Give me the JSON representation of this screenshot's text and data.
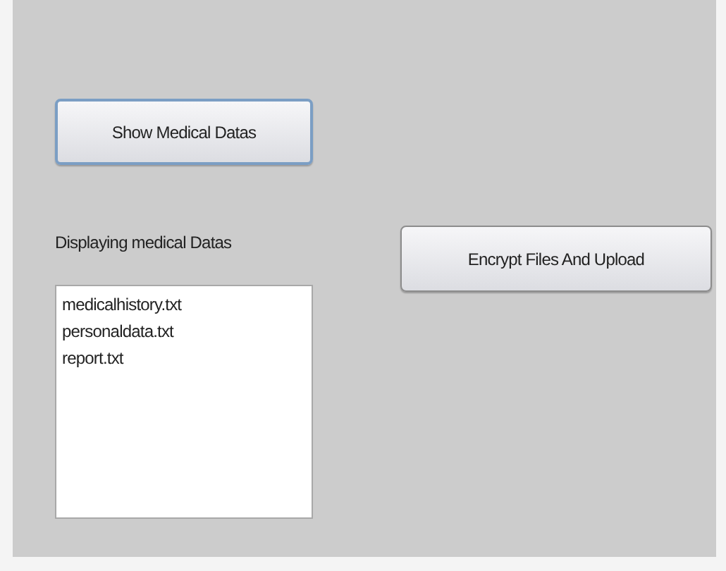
{
  "show_button": {
    "label": "Show Medical Datas",
    "focused": true
  },
  "list_label": "Displaying medical Datas",
  "files": [
    {
      "name": "medicalhistory.txt"
    },
    {
      "name": "personaldata.txt"
    },
    {
      "name": "report.txt"
    }
  ],
  "encrypt_button": {
    "label": "Encrypt Files And Upload",
    "focused": false
  }
}
